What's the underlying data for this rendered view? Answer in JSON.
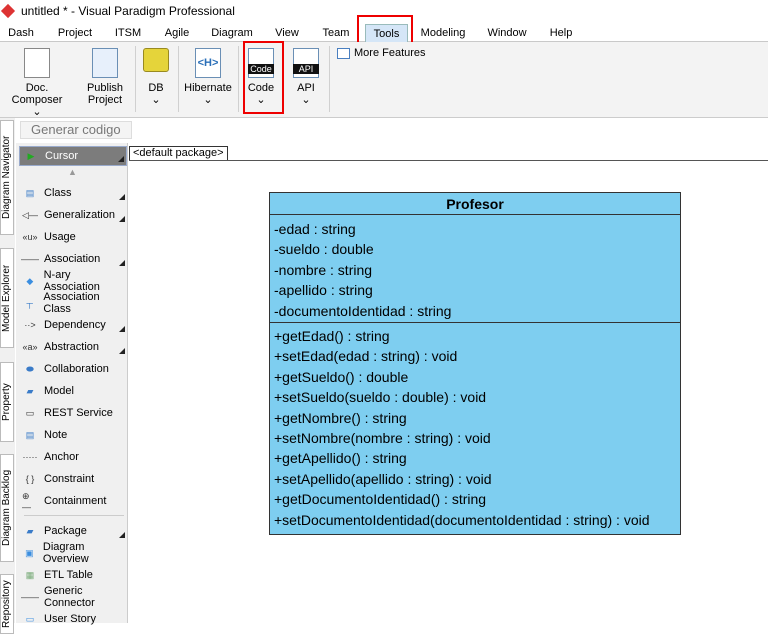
{
  "window": {
    "title": "untitled * - Visual Paradigm Professional"
  },
  "menu": [
    "Dash",
    "Project",
    "ITSM",
    "Agile",
    "Diagram",
    "View",
    "Team",
    "Tools",
    "Modeling",
    "Window",
    "Help"
  ],
  "active_menu": "Tools",
  "ribbon": {
    "doc_composer": [
      "Doc.",
      "Composer"
    ],
    "publish_project": [
      "Publish",
      "Project"
    ],
    "db": "DB",
    "hibernate": "Hibernate",
    "hibernate_icon": "<H>",
    "code": "Code",
    "code_icon": "Code",
    "api": "API",
    "api_icon": "API",
    "more_features": "More Features"
  },
  "breadcrumb": "Generar codigo",
  "side_tabs": [
    "Diagram Navigator",
    "Model Explorer",
    "Property",
    "Diagram Backlog",
    "Repository"
  ],
  "palette": [
    {
      "label": "Cursor",
      "icon": "cursor-arrow-icon"
    },
    {
      "label": "Class",
      "icon": "class-icon"
    },
    {
      "label": "Generalization",
      "icon": "generalization-icon"
    },
    {
      "label": "Usage",
      "icon": "usage-icon"
    },
    {
      "label": "Association",
      "icon": "association-icon"
    },
    {
      "label": "N-ary Association",
      "icon": "diamond-icon"
    },
    {
      "label": "Association Class",
      "icon": "association-class-icon"
    },
    {
      "label": "Dependency",
      "icon": "dependency-icon"
    },
    {
      "label": "Abstraction",
      "icon": "abstraction-icon"
    },
    {
      "label": "Collaboration",
      "icon": "collaboration-icon"
    },
    {
      "label": "Model",
      "icon": "model-icon"
    },
    {
      "label": "REST Service",
      "icon": "rest-service-icon"
    },
    {
      "label": "Note",
      "icon": "note-icon"
    },
    {
      "label": "Anchor",
      "icon": "anchor-icon"
    },
    {
      "label": "Constraint",
      "icon": "constraint-icon"
    },
    {
      "label": "Containment",
      "icon": "containment-icon"
    },
    {
      "label": "Package",
      "icon": "package-icon"
    },
    {
      "label": "Diagram Overview",
      "icon": "diagram-overview-icon"
    },
    {
      "label": "ETL Table",
      "icon": "etl-table-icon"
    },
    {
      "label": "Generic Connector",
      "icon": "generic-connector-icon"
    },
    {
      "label": "User Story",
      "icon": "user-story-icon"
    }
  ],
  "diagram": {
    "package_tab": "<default package>",
    "class": {
      "name": "Profesor",
      "attributes": [
        "-edad : string",
        "-sueldo : double",
        "-nombre : string",
        "-apellido : string",
        "-documentoIdentidad : string"
      ],
      "operations": [
        "+getEdad() : string",
        "+setEdad(edad : string) : void",
        "+getSueldo() : double",
        "+setSueldo(sueldo : double) : void",
        "+getNombre() : string",
        "+setNombre(nombre : string) : void",
        "+getApellido() : string",
        "+setApellido(apellido : string) : void",
        "+getDocumentoIdentidad() : string",
        "+setDocumentoIdentidad(documentoIdentidad : string) : void"
      ]
    }
  },
  "colors": {
    "class_fill": "#7ecef0",
    "highlight": "#e00000",
    "active_tab": "#d5e6f7"
  }
}
